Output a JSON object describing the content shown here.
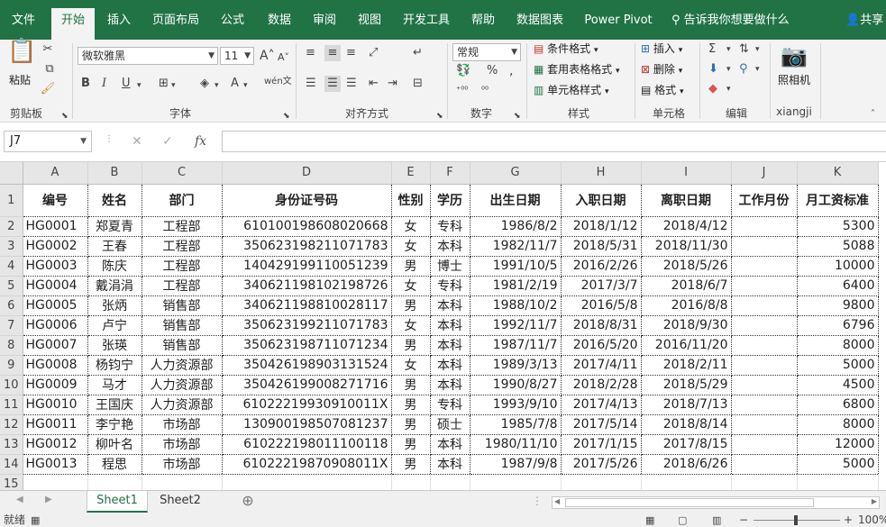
{
  "ribbon_tabs": [
    "文件",
    "开始",
    "插入",
    "页面布局",
    "公式",
    "数据",
    "审阅",
    "视图",
    "开发工具",
    "帮助",
    "数据图表",
    "Power Pivot"
  ],
  "search_hint": "告诉我你想要做什么",
  "share_label": "共享",
  "clipboard": {
    "paste_label": "粘贴",
    "group_label": "剪贴板"
  },
  "font": {
    "name": "微软雅黑",
    "size": "11",
    "group_label": "字体",
    "bold": "B",
    "italic": "I",
    "underline": "U",
    "grow": "A",
    "shrink": "A",
    "wen": "wén"
  },
  "alignment": {
    "group_label": "对齐方式"
  },
  "number": {
    "format": "常规",
    "percent": "%",
    "group_label": "数字"
  },
  "styles": {
    "conditional": "条件格式",
    "table": "套用表格格式",
    "cell": "单元格样式",
    "group_label": "样式"
  },
  "cells": {
    "insert": "插入",
    "delete": "删除",
    "format": "格式",
    "group_label": "单元格"
  },
  "editing": {
    "group_label": "编辑"
  },
  "camera": {
    "label": "照相机",
    "group_label": "xiangji"
  },
  "name_box": "J7",
  "formula_icons": {
    "cancel": "✕",
    "enter": "✓",
    "fx": "fx"
  },
  "columns": [
    "A",
    "B",
    "C",
    "D",
    "E",
    "F",
    "G",
    "H",
    "I",
    "J",
    "K"
  ],
  "headers": [
    "编号",
    "姓名",
    "部门",
    "身份证号码",
    "性别",
    "学历",
    "出生日期",
    "入职日期",
    "离职日期",
    "工作月份",
    "月工资标准"
  ],
  "rows": [
    [
      "HG0001",
      "郑夏青",
      "工程部",
      "610100198608020668",
      "女",
      "专科",
      "1986/8/2",
      "2018/1/12",
      "2018/4/12",
      "",
      "5300"
    ],
    [
      "HG0002",
      "王春",
      "工程部",
      "350623198211071783",
      "女",
      "本科",
      "1982/11/7",
      "2018/5/31",
      "2018/11/30",
      "",
      "5088"
    ],
    [
      "HG0003",
      "陈庆",
      "工程部",
      "140429199110051239",
      "男",
      "博士",
      "1991/10/5",
      "2016/2/26",
      "2018/5/26",
      "",
      "10000"
    ],
    [
      "HG0004",
      "戴涓涓",
      "工程部",
      "340621198102198726",
      "女",
      "专科",
      "1981/2/19",
      "2017/3/7",
      "2018/6/7",
      "",
      "6400"
    ],
    [
      "HG0005",
      "张炳",
      "销售部",
      "340621198810028117",
      "男",
      "本科",
      "1988/10/2",
      "2016/5/8",
      "2016/8/8",
      "",
      "9800"
    ],
    [
      "HG0006",
      "卢宁",
      "销售部",
      "350623199211071783",
      "女",
      "本科",
      "1992/11/7",
      "2018/8/31",
      "2018/9/30",
      "",
      "6796"
    ],
    [
      "HG0007",
      "张瑛",
      "销售部",
      "350623198711071234",
      "男",
      "本科",
      "1987/11/7",
      "2016/5/20",
      "2016/11/20",
      "",
      "8000"
    ],
    [
      "HG0008",
      "杨钧宁",
      "人力资源部",
      "350426198903131524",
      "女",
      "本科",
      "1989/3/13",
      "2017/4/11",
      "2018/2/11",
      "",
      "5000"
    ],
    [
      "HG0009",
      "马才",
      "人力资源部",
      "350426199008271716",
      "男",
      "本科",
      "1990/8/27",
      "2018/2/28",
      "2018/5/29",
      "",
      "4500"
    ],
    [
      "HG0010",
      "王国庆",
      "人力资源部",
      "61022219930910011X",
      "男",
      "专科",
      "1993/9/10",
      "2017/4/13",
      "2018/7/13",
      "",
      "6800"
    ],
    [
      "HG0011",
      "李宁艳",
      "市场部",
      "130900198507081237",
      "男",
      "硕士",
      "1985/7/8",
      "2017/5/14",
      "2018/8/14",
      "",
      "8000"
    ],
    [
      "HG0012",
      "柳叶名",
      "市场部",
      "610222198011100118",
      "男",
      "本科",
      "1980/11/10",
      "2017/1/15",
      "2017/8/15",
      "",
      "12000"
    ],
    [
      "HG0013",
      "程思",
      "市场部",
      "61022219870908011X",
      "男",
      "本科",
      "1987/9/8",
      "2017/5/26",
      "2018/6/26",
      "",
      "5000"
    ]
  ],
  "row_numbers": [
    "1",
    "2",
    "3",
    "4",
    "5",
    "6",
    "7",
    "8",
    "9",
    "10",
    "11",
    "12",
    "13",
    "14",
    "15"
  ],
  "sheets": [
    "Sheet1",
    "Sheet2"
  ],
  "status": {
    "ready": "就绪",
    "zoom": "100%"
  },
  "colors": {
    "accent": "#217346"
  }
}
